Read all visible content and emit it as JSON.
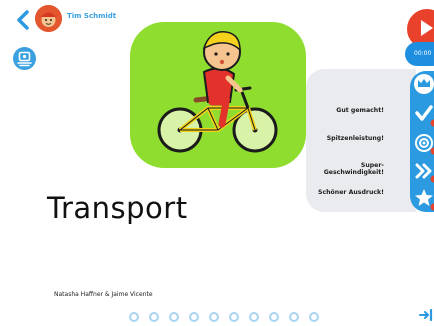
{
  "header": {
    "user_name": "Tim Schmidt"
  },
  "book": {
    "title": "Transport",
    "authors": "Natasha Haffner & Jaime Vicente"
  },
  "recorder": {
    "timer": "00:00"
  },
  "awards": [
    {
      "label": "Gut gemacht!",
      "icon": "crown-icon"
    },
    {
      "label": "Spitzenleistung!",
      "icon": "checkmark-icon"
    },
    {
      "label": "Super-Geschwindigkeit!",
      "icon": "fast-forward-icon"
    },
    {
      "label": "Schöner Ausdruck!",
      "icon": "star-icon"
    }
  ],
  "colors": {
    "accent_blue": "#2b9ae0",
    "cover_green": "#8fde2f",
    "record_red": "#e8412c",
    "panel_grey": "#e9ebee"
  }
}
